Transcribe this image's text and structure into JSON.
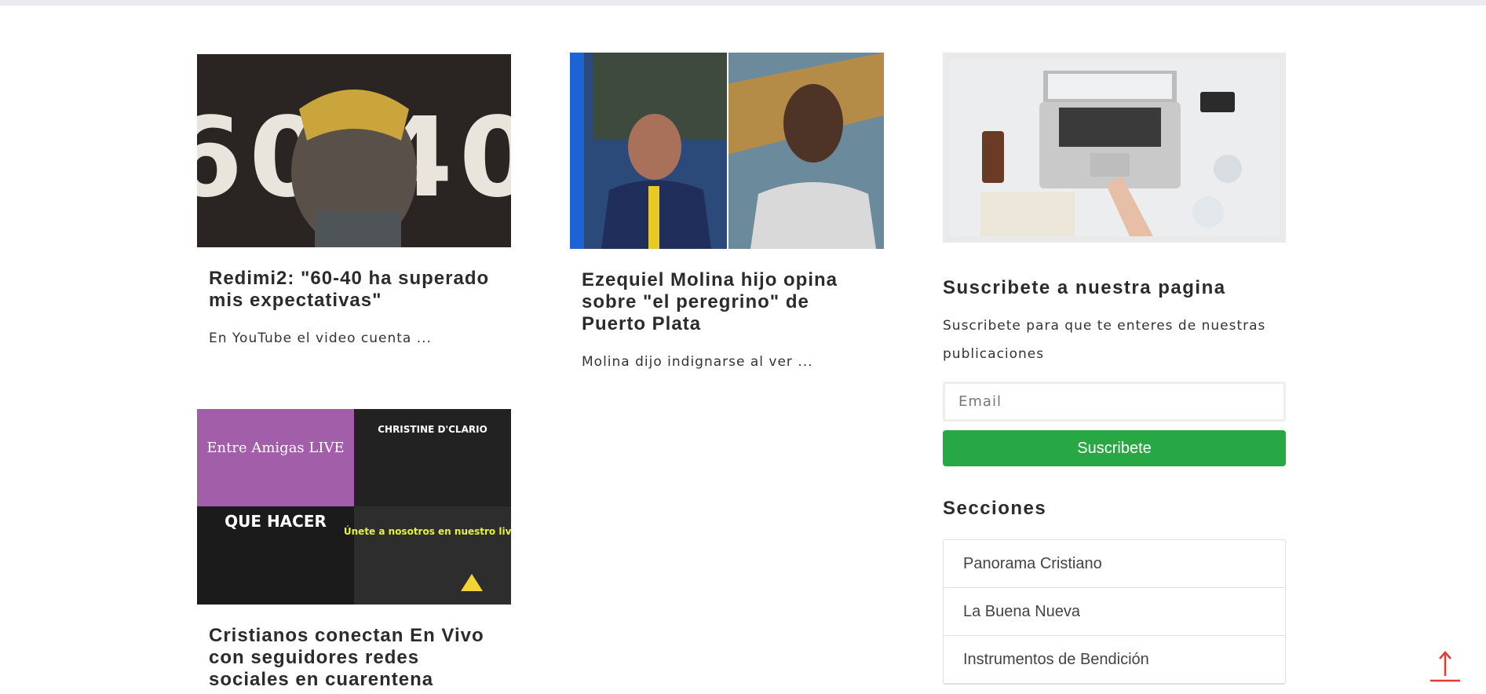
{
  "articles": [
    {
      "title": "Redimi2: \"60-40 ha superado mis expectativas\"",
      "excerpt": "En YouTube el video cuenta ...",
      "image_label": "60 40"
    },
    {
      "title": "Ezequiel Molina hijo opina sobre \"el peregrino\" de Puerto Plata",
      "excerpt": "Molina dijo indignarse al ver ..."
    },
    {
      "title": "Cristianos conectan En Vivo con seguidores redes sociales en cuarentena",
      "image_tiles": [
        "Entre Amigas LIVE",
        "CHRISTINE D'CLARIO",
        "QUE HACER",
        "Únete a nosotros en nuestro live."
      ]
    }
  ],
  "sidebar": {
    "subscribe_heading": "Suscribete a nuestra pagina",
    "subscribe_text": "Suscribete para que te enteres de nuestras publicaciones",
    "email_placeholder": "Email",
    "subscribe_button": "Suscribete",
    "sections_heading": "Secciones",
    "sections": [
      "Panorama Cristiano",
      "La Buena Nueva",
      "Instrumentos de Bendición"
    ]
  },
  "colors": {
    "accent_green": "#28a745",
    "back_to_top": "#e53935"
  },
  "icons": {
    "back_to_top": "arrow-up-icon"
  }
}
